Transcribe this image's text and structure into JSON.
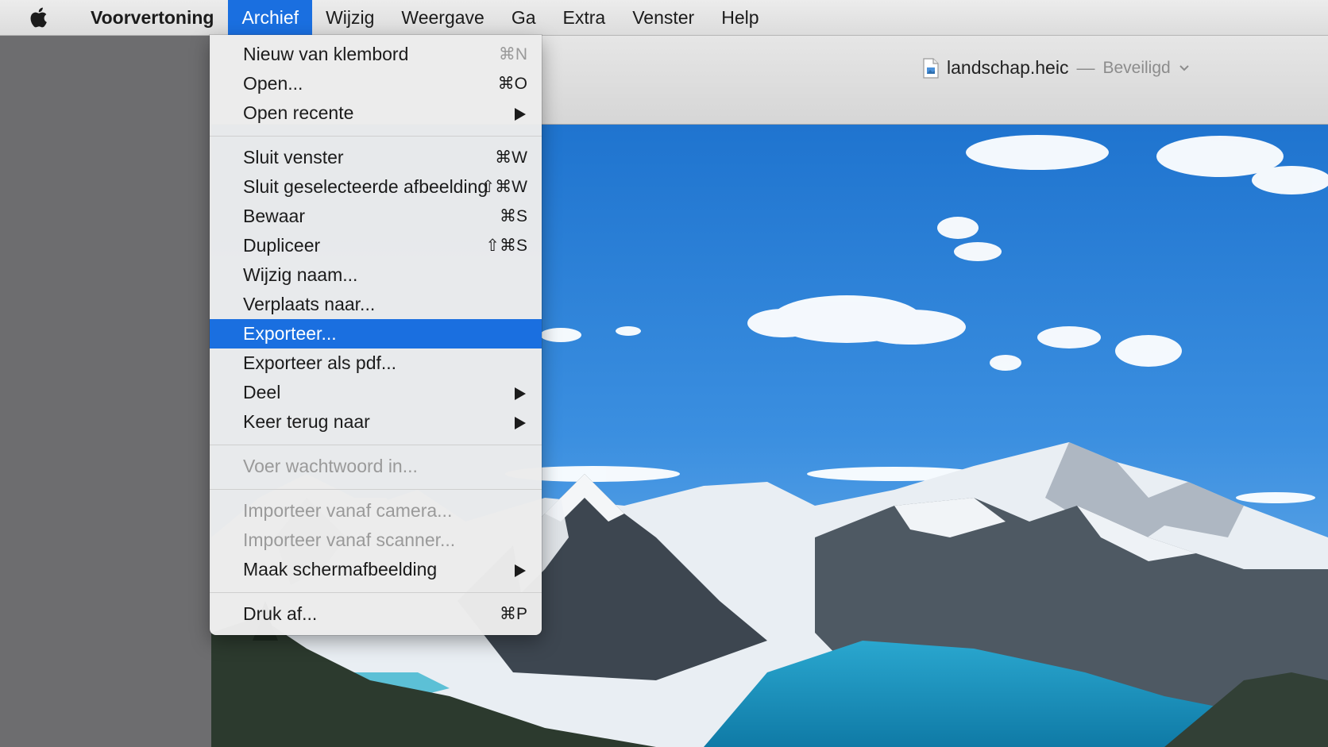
{
  "menubar": {
    "app_name": "Voorvertoning",
    "items": [
      "Archief",
      "Wijzig",
      "Weergave",
      "Ga",
      "Extra",
      "Venster",
      "Help"
    ],
    "active_item": "Archief"
  },
  "window": {
    "filename": "landschap.heic",
    "separator": "—",
    "status": "Beveiligd"
  },
  "archief_menu": {
    "group1": [
      {
        "label": "Nieuw van klembord",
        "shortcut": "⌘N"
      },
      {
        "label": "Open...",
        "shortcut": "⌘O"
      },
      {
        "label": "Open recente",
        "submenu": true
      }
    ],
    "group2": [
      {
        "label": "Sluit venster",
        "shortcut": "⌘W"
      },
      {
        "label": "Sluit geselecteerde afbeelding",
        "shortcut": "⇧⌘W"
      },
      {
        "label": "Bewaar",
        "shortcut": "⌘S"
      },
      {
        "label": "Dupliceer",
        "shortcut": "⇧⌘S"
      },
      {
        "label": "Wijzig naam..."
      },
      {
        "label": "Verplaats naar..."
      },
      {
        "label": "Exporteer...",
        "highlighted": true
      },
      {
        "label": "Exporteer als pdf..."
      },
      {
        "label": "Deel",
        "submenu": true
      },
      {
        "label": "Keer terug naar",
        "submenu": true
      }
    ],
    "group3": [
      {
        "label": "Voer wachtwoord in...",
        "disabled": true
      }
    ],
    "group4": [
      {
        "label": "Importeer vanaf camera...",
        "disabled": true
      },
      {
        "label": "Importeer vanaf scanner...",
        "disabled": true
      },
      {
        "label": "Maak schermafbeelding",
        "submenu": true
      }
    ],
    "group5": [
      {
        "label": "Druk af...",
        "shortcut": "⌘P"
      }
    ]
  },
  "icons": {
    "apple": "apple-logo-icon",
    "document": "document-icon",
    "chevron": "chevron-down-icon",
    "submenu_arrow": "submenu-arrow-icon"
  },
  "colors": {
    "highlight": "#1a6fe0",
    "sky": "#2f86d9",
    "lake": "#1e9bc4"
  }
}
